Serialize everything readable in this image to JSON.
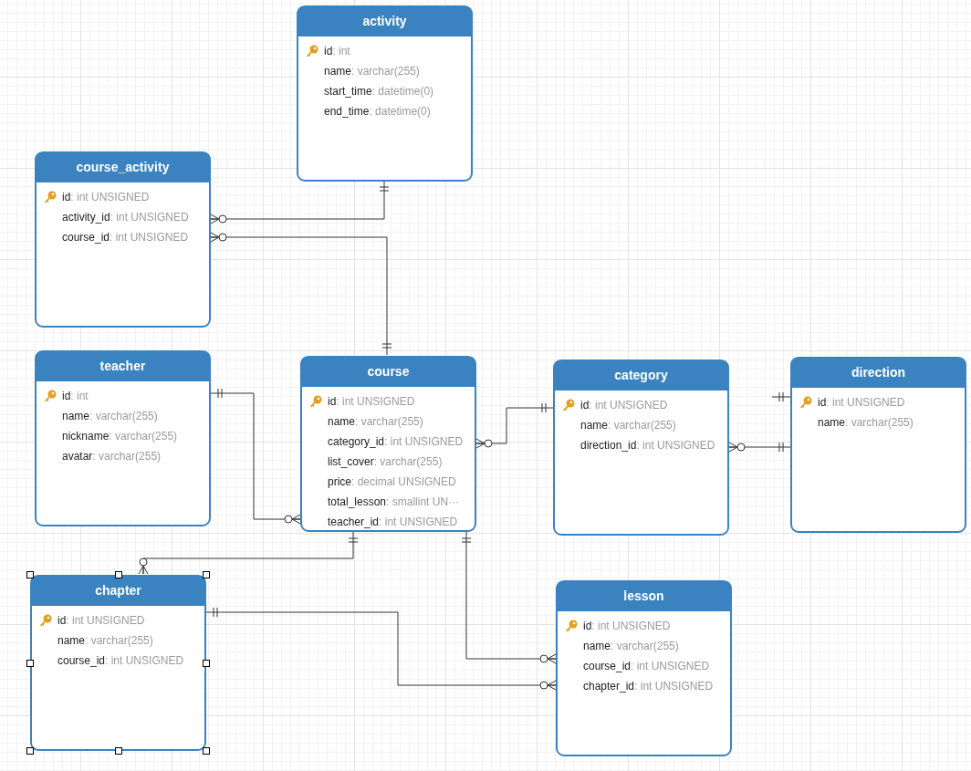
{
  "tables": [
    {
      "name": "activity",
      "selected": false,
      "columns": [
        {
          "name": "id",
          "type": ": int",
          "primary_key": true
        },
        {
          "name": "name",
          "type": ": varchar(255)",
          "primary_key": false
        },
        {
          "name": "start_time",
          "type": ": datetime(0)",
          "primary_key": false
        },
        {
          "name": "end_time",
          "type": ": datetime(0)",
          "primary_key": false
        }
      ]
    },
    {
      "name": "course_activity",
      "selected": false,
      "columns": [
        {
          "name": "id",
          "type": ": int UNSIGNED",
          "primary_key": true
        },
        {
          "name": "activity_id",
          "type": ": int UNSIGNED",
          "primary_key": false
        },
        {
          "name": "course_id",
          "type": ": int UNSIGNED",
          "primary_key": false
        }
      ]
    },
    {
      "name": "teacher",
      "selected": false,
      "columns": [
        {
          "name": "id",
          "type": ": int",
          "primary_key": true
        },
        {
          "name": "name",
          "type": ": varchar(255)",
          "primary_key": false
        },
        {
          "name": "nickname",
          "type": ": varchar(255)",
          "primary_key": false
        },
        {
          "name": "avatar",
          "type": ": varchar(255)",
          "primary_key": false
        }
      ]
    },
    {
      "name": "course",
      "selected": false,
      "columns": [
        {
          "name": "id",
          "type": ": int UNSIGNED",
          "primary_key": true
        },
        {
          "name": "name",
          "type": ": varchar(255)",
          "primary_key": false
        },
        {
          "name": "category_id",
          "type": ": int UNSIGNED",
          "primary_key": false
        },
        {
          "name": "list_cover",
          "type": ": varchar(255)",
          "primary_key": false
        },
        {
          "name": "price",
          "type": ": decimal UNSIGNED",
          "primary_key": false
        },
        {
          "name": "total_lesson",
          "type": ": smallint UN···",
          "primary_key": false
        },
        {
          "name": "teacher_id",
          "type": ": int UNSIGNED",
          "primary_key": false
        }
      ]
    },
    {
      "name": "category",
      "selected": false,
      "columns": [
        {
          "name": "id",
          "type": ": int UNSIGNED",
          "primary_key": true
        },
        {
          "name": "name",
          "type": ": varchar(255)",
          "primary_key": false
        },
        {
          "name": "direction_id",
          "type": ": int UNSIGNED",
          "primary_key": false
        }
      ]
    },
    {
      "name": "direction",
      "selected": false,
      "columns": [
        {
          "name": "id",
          "type": ": int UNSIGNED",
          "primary_key": true
        },
        {
          "name": "name",
          "type": ": varchar(255)",
          "primary_key": false
        }
      ]
    },
    {
      "name": "chapter",
      "selected": true,
      "columns": [
        {
          "name": "id",
          "type": ": int UNSIGNED",
          "primary_key": true
        },
        {
          "name": "name",
          "type": ": varchar(255)",
          "primary_key": false
        },
        {
          "name": "course_id",
          "type": ": int UNSIGNED",
          "primary_key": false
        }
      ]
    },
    {
      "name": "lesson",
      "selected": false,
      "columns": [
        {
          "name": "id",
          "type": ": int UNSIGNED",
          "primary_key": true
        },
        {
          "name": "name",
          "type": ": varchar(255)",
          "primary_key": false
        },
        {
          "name": "course_id",
          "type": ": int UNSIGNED",
          "primary_key": false
        },
        {
          "name": "chapter_id",
          "type": ": int UNSIGNED",
          "primary_key": false
        }
      ]
    }
  ],
  "relations": [
    {
      "start_many": false,
      "finish_many": true
    },
    {
      "start_many": true,
      "finish_many": false
    },
    {
      "start_many": false,
      "finish_many": true
    },
    {
      "start_many": true,
      "finish_many": false
    },
    {
      "start_many": true,
      "finish_many": false
    },
    {
      "start_many": false,
      "finish_many": true
    },
    {
      "start_many": false,
      "finish_many": true
    },
    {
      "start_many": false,
      "finish_many": true
    }
  ]
}
